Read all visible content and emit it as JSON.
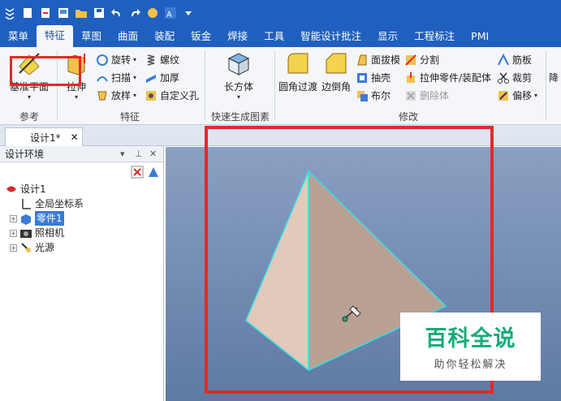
{
  "quick_access": {
    "icons": [
      "app-menu-icon",
      "new-file-icon",
      "open-icon",
      "save-as-icon",
      "folder-icon",
      "save-icon",
      "undo-icon",
      "redo-icon",
      "smart-icon",
      "design-icon",
      "dropdown-icon"
    ]
  },
  "tabs": [
    "菜单",
    "特征",
    "草图",
    "曲面",
    "装配",
    "钣金",
    "焊接",
    "工具",
    "智能设计批注",
    "显示",
    "工程标注",
    "PMI"
  ],
  "active_tab": "特征",
  "ribbon": {
    "groups": {
      "reference": "参考",
      "feature": "特征",
      "quick": "快速生成图素",
      "modify": "修改"
    },
    "buttons": {
      "datum_plane": "基准平面",
      "extrude": "拉伸",
      "revolve": "旋转",
      "sweep": "扫描",
      "loft": "放样",
      "thread": "螺纹",
      "thicken": "加厚",
      "custom_hole": "自定义孔",
      "box": "长方体",
      "fillet": "圆角过渡",
      "chamfer": "边倒角",
      "draft": "面拔模",
      "shell": "抽壳",
      "boolean": "布尔",
      "split": "分割",
      "extrude_part": "拉伸零件/装配体",
      "delete_body": "删除体",
      "rib": "筋板",
      "trim": "裁剪",
      "offset": "偏移",
      "cut_off": "降"
    }
  },
  "document_tab": "设计1*",
  "panel": {
    "title": "设计环境",
    "tree": {
      "root": "设计1",
      "coord": "全局坐标系",
      "part": "零件1",
      "camera": "照相机",
      "light": "光源"
    }
  },
  "watermark": {
    "title": "百科全说",
    "subtitle": "助你轻松解决"
  },
  "colors": {
    "accent": "#1f5fbf",
    "highlight": "#e02a2a",
    "watermark": "#1aa97a",
    "face_light": "#e2c9ba",
    "face_dark": "#b9a293",
    "edge": "#35e0e8"
  }
}
